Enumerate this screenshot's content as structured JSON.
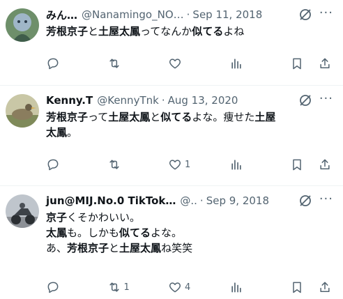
{
  "tweets": [
    {
      "name": "みん…",
      "handle": "@Nanamingo_NO…",
      "date": "Sep 11, 2018",
      "text": [
        [
          {
            "t": "芳根京子",
            "b": true
          },
          {
            "t": "と",
            "b": false
          },
          {
            "t": "土屋太鳳",
            "b": true
          },
          {
            "t": "ってなんか",
            "b": false
          },
          {
            "t": "似てる",
            "b": true
          },
          {
            "t": "よね",
            "b": false
          }
        ]
      ],
      "counts": {
        "reply": "",
        "retweet": "",
        "like": ""
      }
    },
    {
      "name": "Kenny.T",
      "handle": "@KennyTnk",
      "date": "Aug 13, 2020",
      "text": [
        [
          {
            "t": "芳根京子",
            "b": true
          },
          {
            "t": "って",
            "b": false
          },
          {
            "t": "土屋太鳳",
            "b": true
          },
          {
            "t": "と",
            "b": false
          },
          {
            "t": "似てる",
            "b": true
          },
          {
            "t": "よな。痩せた",
            "b": false
          },
          {
            "t": "土屋",
            "b": true
          }
        ],
        [
          {
            "t": "太鳳",
            "b": true
          },
          {
            "t": "。",
            "b": false
          }
        ]
      ],
      "counts": {
        "reply": "",
        "retweet": "",
        "like": "1"
      }
    },
    {
      "name": "jun@MIJ.No.0 TikTok…",
      "handle": "@..",
      "date": "Sep 9, 2018",
      "text": [
        [
          {
            "t": "京子",
            "b": true
          },
          {
            "t": "くそかわいい。",
            "b": false
          }
        ],
        [
          {
            "t": "太鳳",
            "b": true
          },
          {
            "t": "も。しかも",
            "b": false
          },
          {
            "t": "似てる",
            "b": true
          },
          {
            "t": "よな。",
            "b": false
          }
        ],
        [
          {
            "t": "あ、",
            "b": false
          },
          {
            "t": "芳根京子",
            "b": true
          },
          {
            "t": "と",
            "b": false
          },
          {
            "t": "土屋太鳳",
            "b": true
          },
          {
            "t": "ね笑笑",
            "b": false
          }
        ]
      ],
      "counts": {
        "reply": "",
        "retweet": "1",
        "like": "4"
      }
    }
  ],
  "ui": {
    "separator": "·",
    "more": "···"
  },
  "icons": {
    "grok": "grok-slash-icon",
    "reply": "reply-icon",
    "retweet": "retweet-icon",
    "like": "like-icon",
    "views": "views-icon",
    "bookmark": "bookmark-icon",
    "share": "share-icon"
  },
  "colors": {
    "text": "#0f1419",
    "secondary": "#536471",
    "divider": "#eff3f4"
  }
}
